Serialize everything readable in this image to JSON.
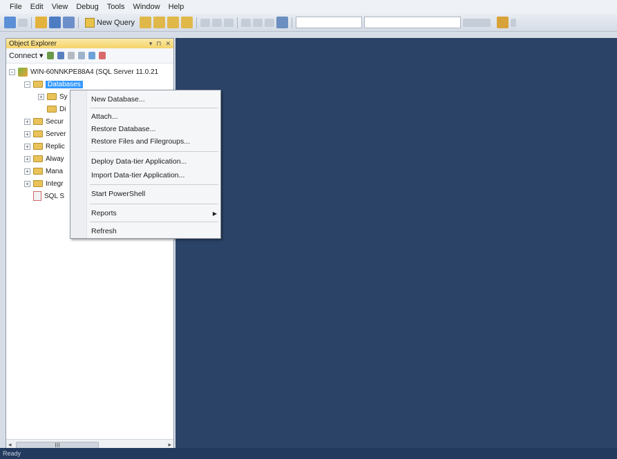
{
  "menubar": {
    "items": [
      "File",
      "Edit",
      "View",
      "Debug",
      "Tools",
      "Window",
      "Help"
    ]
  },
  "toolbar": {
    "new_query_label": "New Query"
  },
  "object_explorer": {
    "title": "Object Explorer",
    "title_controls": [
      "▾",
      "⊓",
      "✕"
    ],
    "connect_label": "Connect ▾",
    "tree": {
      "server": "WIN-60NNKPE88A4 (SQL Server 11.0.21",
      "databases": "Databases",
      "sys": "Sy",
      "db": "Di",
      "security": "Secur",
      "server_objects": "Server",
      "replication": "Replic",
      "alwayson": "Alway",
      "management": "Mana",
      "integration": "Integr",
      "sql_agent": "SQL S"
    },
    "scroll_thumb": "III"
  },
  "context_menu": {
    "items": [
      "New Database...",
      "Attach...",
      "Restore Database...",
      "Restore Files and Filegroups...",
      "Deploy Data-tier Application...",
      "Import Data-tier Application...",
      "Start PowerShell",
      "Reports",
      "Refresh"
    ]
  },
  "statusbar": {
    "text": "Ready"
  },
  "colors": {
    "doc_background": "#2b4366",
    "selection": "#3399ff",
    "panel_title": "#f4d36a"
  }
}
